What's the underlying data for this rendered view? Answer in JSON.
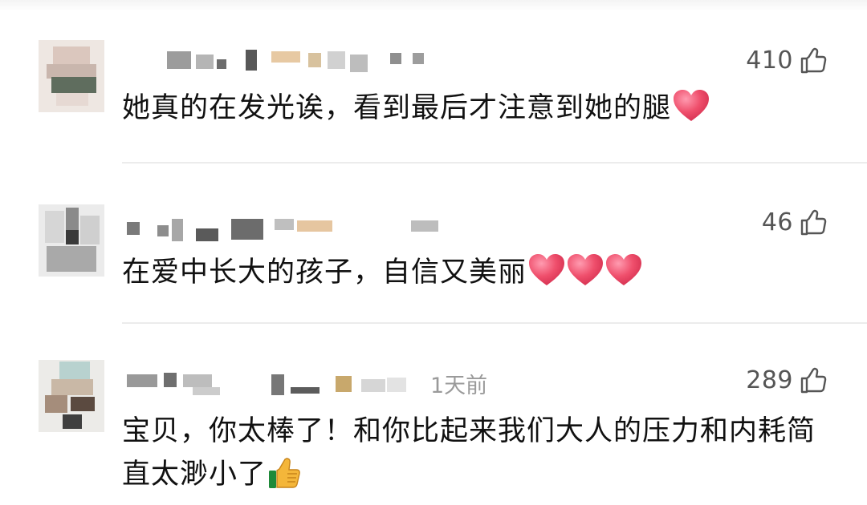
{
  "comments": [
    {
      "like_count": "410",
      "text": "她真的在发光诶，看到最后才注意到她的腿",
      "emojis": [
        "heart-emoji"
      ],
      "timestamp": ""
    },
    {
      "like_count": "46",
      "text": "在爱中长大的孩子，自信又美丽",
      "emojis": [
        "heart-emoji",
        "heart-emoji",
        "heart-emoji"
      ],
      "timestamp": ""
    },
    {
      "like_count": "289",
      "text": "宝贝，你太棒了！和你比起来我们大人的压力和内耗简直太渺小了",
      "emojis": [
        "thumbs-up-emoji"
      ],
      "timestamp": "1天前"
    }
  ],
  "colors": {
    "text": "#111111",
    "count": "#555555",
    "timestamp": "#9a9a9a",
    "divider": "#ececec",
    "heart": "#e8415f"
  },
  "icons": {
    "like": "thumbs-up-outline-icon"
  }
}
